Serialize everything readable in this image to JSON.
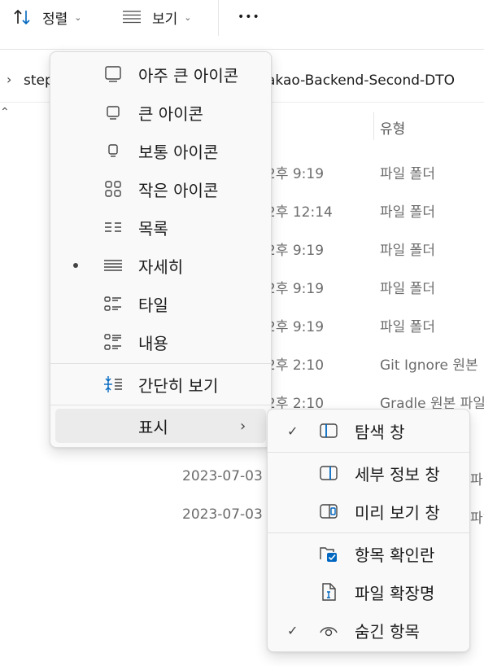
{
  "toolbar": {
    "sort_label": "정렬",
    "view_label": "보기",
    "more_label": "•••"
  },
  "address": {
    "left_segment": "step",
    "right_segment": "akao-Backend-Second-DTO"
  },
  "columns": {
    "type_header": "유형"
  },
  "rows": [
    {
      "time": "2후 9:19",
      "type": "파일 폴더"
    },
    {
      "time": "2후 12:14",
      "type": "파일 폴더"
    },
    {
      "time": "2후 9:19",
      "type": "파일 폴더"
    },
    {
      "time": "2후 9:19",
      "type": "파일 폴더"
    },
    {
      "time": "2후 9:19",
      "type": "파일 폴더"
    },
    {
      "time": "2후 2:10",
      "type": "Git Ignore 원본"
    },
    {
      "time": "2후 2:10",
      "type": "Gradle 원본 파일"
    }
  ],
  "partial_rows": [
    {
      "date": "2023-07-03",
      "tail": "파"
    },
    {
      "date": "2023-07-03",
      "tail": "파일"
    }
  ],
  "view_menu": {
    "items": [
      {
        "label": "아주 큰 아이콘",
        "icon": "extra-large-icons-icon"
      },
      {
        "label": "큰 아이콘",
        "icon": "large-icons-icon"
      },
      {
        "label": "보통 아이콘",
        "icon": "medium-icons-icon"
      },
      {
        "label": "작은 아이콘",
        "icon": "small-icons-icon"
      },
      {
        "label": "목록",
        "icon": "list-icon"
      },
      {
        "label": "자세히",
        "icon": "details-icon",
        "selected": true
      },
      {
        "label": "타일",
        "icon": "tiles-icon"
      },
      {
        "label": "내용",
        "icon": "content-icon"
      }
    ],
    "compact_label": "간단히 보기",
    "show_label": "표시"
  },
  "show_menu": {
    "items": [
      {
        "label": "탐색 창",
        "icon": "navigation-pane-icon",
        "checked": true
      },
      {
        "label": "세부 정보 창",
        "icon": "details-pane-icon",
        "checked": false
      },
      {
        "label": "미리 보기 창",
        "icon": "preview-pane-icon",
        "checked": false
      },
      {
        "label": "항목 확인란",
        "icon": "item-checkboxes-icon",
        "checked": false
      },
      {
        "label": "파일 확장명",
        "icon": "file-extensions-icon",
        "checked": false
      },
      {
        "label": "숨긴 항목",
        "icon": "hidden-items-icon",
        "checked": true
      }
    ]
  },
  "colors": {
    "accent": "#0067c0",
    "menu_bg": "#f9f9f9",
    "secondary_text": "#6c6c6c"
  }
}
